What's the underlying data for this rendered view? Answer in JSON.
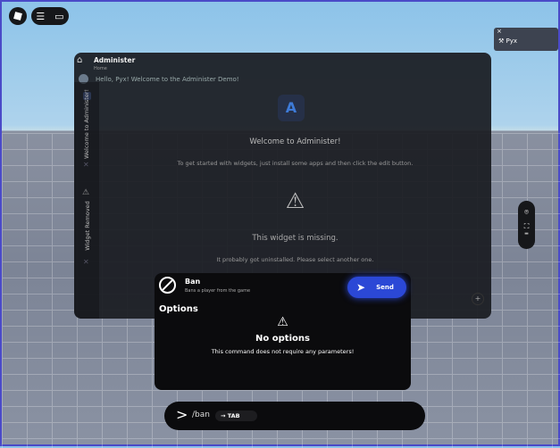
{
  "topbar": {
    "menu_icon": "hamburger-icon",
    "chat_icon": "chat-icon"
  },
  "notification": {
    "close": "×",
    "name": "Pyx"
  },
  "panel": {
    "app_title": "Administer",
    "breadcrumb": "Home",
    "greeting": "Hello, Pyx! Welcome to the Administer Demo!",
    "sidebar": [
      {
        "label": "Welcome to Administer!"
      },
      {
        "label": "Widget Removed"
      }
    ],
    "welcome_title": "Welcome to Administer!",
    "welcome_text": "To get started with widgets, just install some apps and then click the edit button.",
    "missing_title": "This widget is missing.",
    "missing_text": "It probably got uninstalled. Please select another one.",
    "add": "+"
  },
  "command": {
    "name": "Ban",
    "description": "Bans a player from the game",
    "send_label": "Send",
    "options_title": "Options",
    "empty_title": "No options",
    "empty_text": "This command does not require any parameters!"
  },
  "commandbar": {
    "prompt": ">",
    "input": "/ban",
    "hint": "→ TAB"
  }
}
